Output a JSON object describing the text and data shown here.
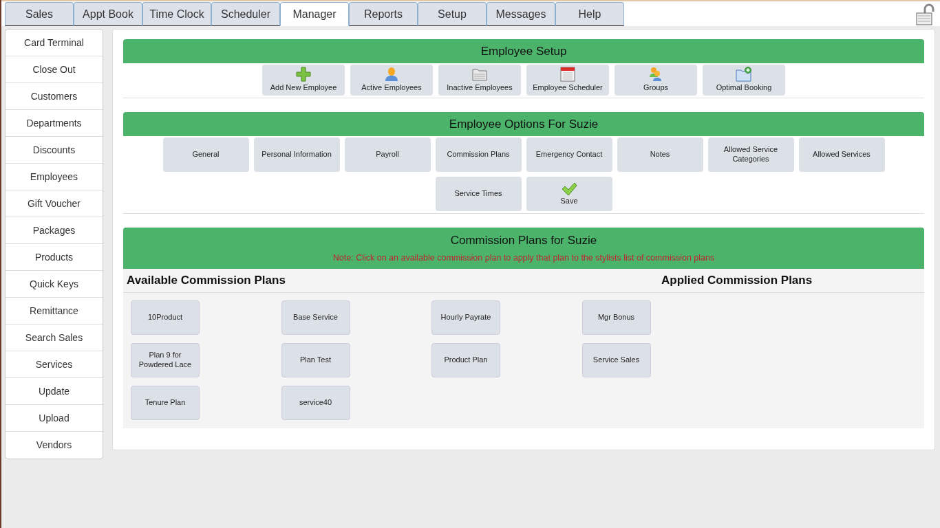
{
  "tabs": [
    {
      "label": "Sales",
      "selected": false
    },
    {
      "label": "Appt Book",
      "selected": false
    },
    {
      "label": "Time Clock",
      "selected": false
    },
    {
      "label": "Scheduler",
      "selected": false
    },
    {
      "label": "Manager",
      "selected": true
    },
    {
      "label": "Reports",
      "selected": false
    },
    {
      "label": "Setup",
      "selected": false
    },
    {
      "label": "Messages",
      "selected": false
    },
    {
      "label": "Help",
      "selected": false
    }
  ],
  "sidebar": {
    "items": [
      "Card Terminal",
      "Close Out",
      "Customers",
      "Departments",
      "Discounts",
      "Employees",
      "Gift Voucher",
      "Packages",
      "Products",
      "Quick Keys",
      "Remittance",
      "Search Sales",
      "Services",
      "Update",
      "Upload",
      "Vendors"
    ]
  },
  "employee_setup": {
    "title": "Employee Setup",
    "buttons": [
      {
        "label": "Add New Employee",
        "kind": "add"
      },
      {
        "label": "Active Employees",
        "kind": "person"
      },
      {
        "label": "Inactive Employees",
        "kind": "folder"
      },
      {
        "label": "Employee Scheduler",
        "kind": "calendar"
      },
      {
        "label": "Groups",
        "kind": "group"
      },
      {
        "label": "Optimal Booking",
        "kind": "folder-add"
      }
    ]
  },
  "employee_options": {
    "title": "Employee Options For Suzie",
    "buttons": [
      {
        "label": "General",
        "kind": "plain"
      },
      {
        "label": "Personal Information",
        "kind": "plain"
      },
      {
        "label": "Payroll",
        "kind": "plain"
      },
      {
        "label": "Commission Plans",
        "kind": "plain"
      },
      {
        "label": "Emergency Contact",
        "kind": "plain"
      },
      {
        "label": "Notes",
        "kind": "plain"
      },
      {
        "label": "Allowed Service Categories",
        "kind": "plain"
      },
      {
        "label": "Allowed Services",
        "kind": "plain"
      },
      {
        "label": "Service Times",
        "kind": "plain"
      },
      {
        "label": "Save",
        "kind": "save"
      }
    ]
  },
  "commission_plans": {
    "title": "Commission Plans for Suzie",
    "note": "Note: Click on an available commission plan to apply that plan to the stylists list of commission plans",
    "available_heading": "Available Commission Plans",
    "applied_heading": "Applied Commission Plans",
    "available": [
      "10Product",
      "Base Service",
      "Hourly Payrate",
      "Mgr Bonus",
      "Plan 9 for Powdered Lace",
      "Plan Test",
      "Product Plan",
      "Service Sales",
      "Tenure Plan",
      "service40"
    ]
  }
}
